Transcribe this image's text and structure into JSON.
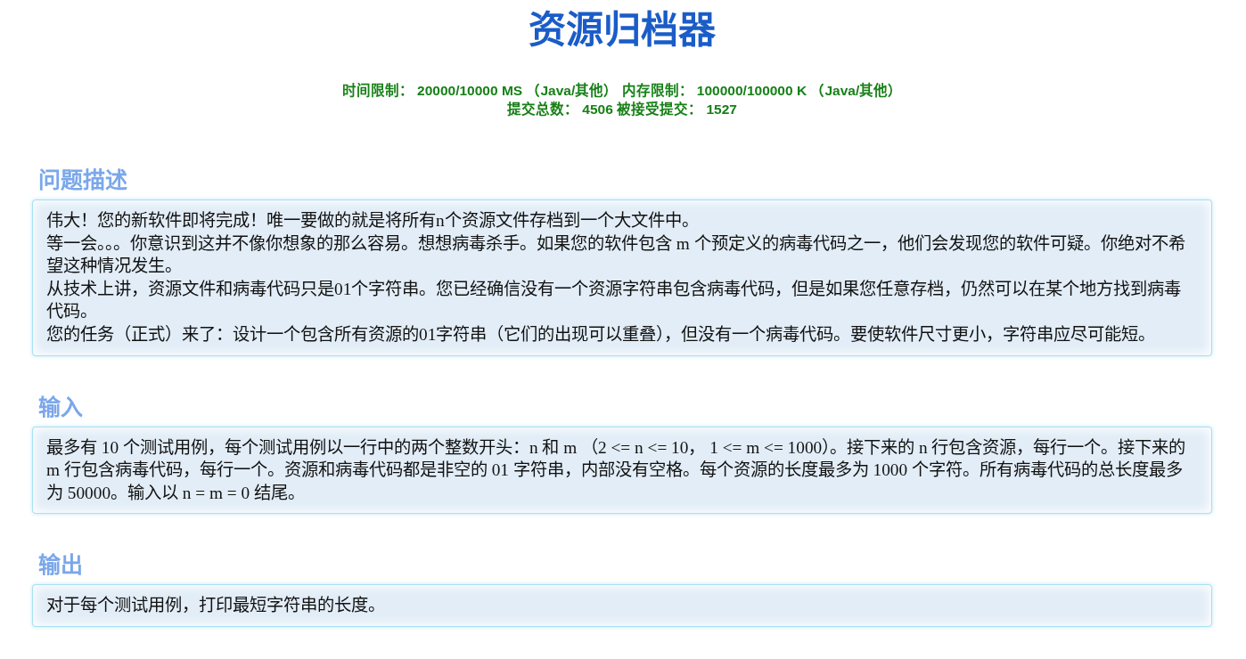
{
  "title": "资源归档器",
  "limits": [
    "时间限制： 20000/10000 MS （Java/其他） 内存限制： 100000/100000 K （Java/其他）",
    "提交总数： 4506 被接受提交： 1527"
  ],
  "sections": [
    {
      "heading": "问题描述",
      "paragraphs": [
        "伟大！您的新软件即将完成！唯一要做的就是将所有n个资源文件存档到一个大文件中。",
        "等一会。。。你意识到这并不像你想象的那么容易。想想病毒杀手。如果您的软件包含 m 个预定义的病毒代码之一，他们会发现您的软件可疑。你绝对不希望这种情况发生。",
        "从技术上讲，资源文件和病毒代码只是01个字符串。您已经确信没有一个资源字符串包含病毒代码，但是如果您任意存档，仍然可以在某个地方找到病毒代码。",
        "您的任务（正式）来了：设计一个包含所有资源的01字符串（它们的出现可以重叠），但没有一个病毒代码。要使软件尺寸更小，字符串应尽可能短。"
      ]
    },
    {
      "heading": "输入",
      "paragraphs": [
        "最多有 10 个测试用例，每个测试用例以一行中的两个整数开头：n 和 m （2 <= n <= 10， 1 <= m <= 1000）。接下来的 n 行包含资源，每行一个。接下来的 m 行包含病毒代码，每行一个。资源和病毒代码都是非空的 01 字符串，内部没有空格。每个资源的长度最多为 1000 个字符。所有病毒代码的总长度最多为 50000。输入以 n = m = 0 结尾。"
      ]
    },
    {
      "heading": "输出",
      "paragraphs": [
        "对于每个测试用例，打印最短字符串的长度。"
      ]
    }
  ]
}
